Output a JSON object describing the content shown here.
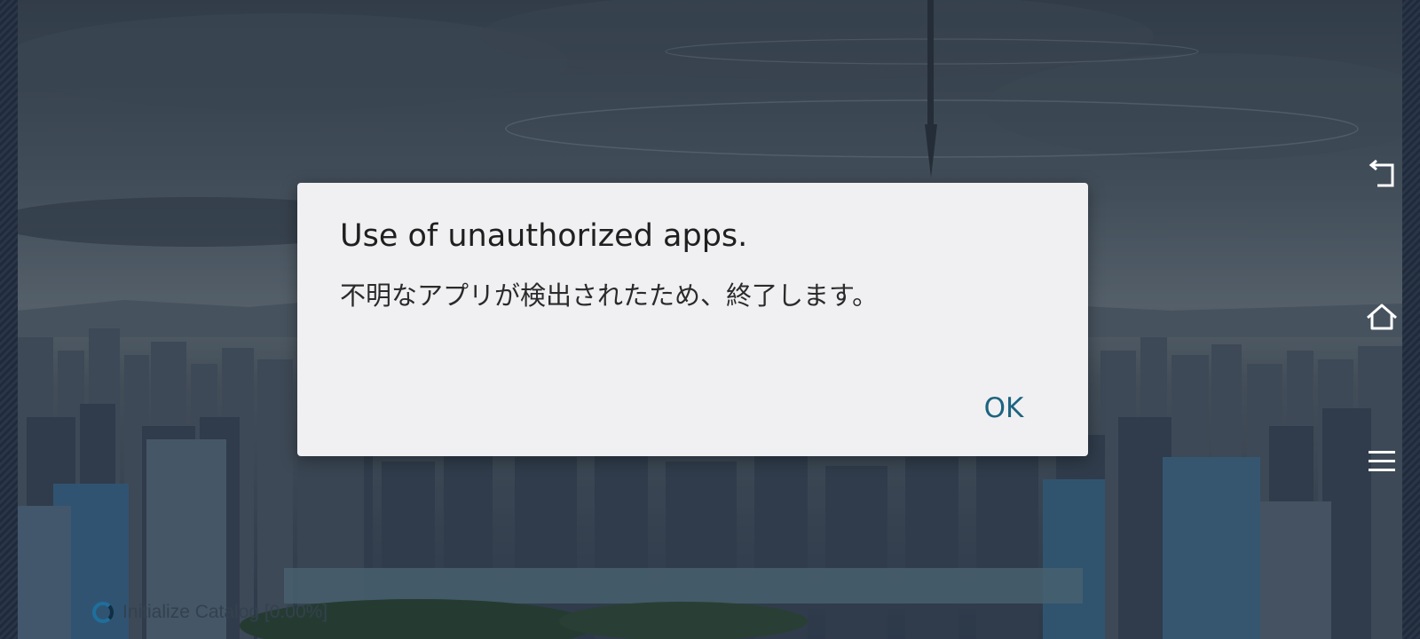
{
  "dialog": {
    "title": "Use of unauthorized apps.",
    "message": "不明なアプリが検出されたため、終了します。",
    "ok_label": "OK"
  },
  "loading": {
    "text": "Initialize Catalog [0.00%]",
    "progress": 0.0
  },
  "nav_buttons": {
    "back_icon": "back-icon",
    "home_icon": "home-icon",
    "menu_icon": "menu-icon"
  },
  "colors": {
    "dialog_background": "#f0f0f2",
    "ok_accent": "#1d6480",
    "spinner": "#1e6f9c"
  }
}
